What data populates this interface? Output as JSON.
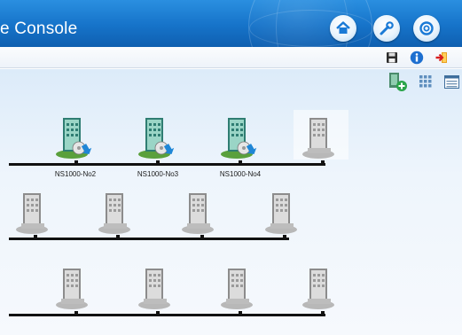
{
  "header": {
    "title": "e Console",
    "buttons": [
      {
        "icon": "home-icon"
      },
      {
        "icon": "wrench-icon"
      },
      {
        "icon": "help-icon"
      }
    ]
  },
  "toolbar": {
    "icons": [
      "save-icon",
      "info-icon",
      "logout-icon"
    ]
  },
  "view_tools": {
    "icons": [
      "add-device-icon",
      "grid-view-icon",
      "list-view-icon"
    ]
  },
  "colors": {
    "header_blue": "#1673c9",
    "bus_line": "#111111",
    "canvas_bg": "#e6f0fa"
  },
  "topology": {
    "rows": [
      {
        "nodes": [
          {
            "label": "NS1000-No2",
            "status": "online"
          },
          {
            "label": "NS1000-No3",
            "status": "online"
          },
          {
            "label": "NS1000-No4",
            "status": "online"
          },
          {
            "label": "",
            "status": "offline-selected"
          }
        ]
      },
      {
        "nodes": [
          {
            "label": "",
            "status": "offline"
          },
          {
            "label": "",
            "status": "offline"
          },
          {
            "label": "",
            "status": "offline"
          },
          {
            "label": "",
            "status": "offline"
          }
        ]
      },
      {
        "nodes": [
          {
            "label": "",
            "status": "offline"
          },
          {
            "label": "",
            "status": "offline"
          },
          {
            "label": "",
            "status": "offline"
          },
          {
            "label": "",
            "status": "offline"
          }
        ]
      }
    ]
  }
}
